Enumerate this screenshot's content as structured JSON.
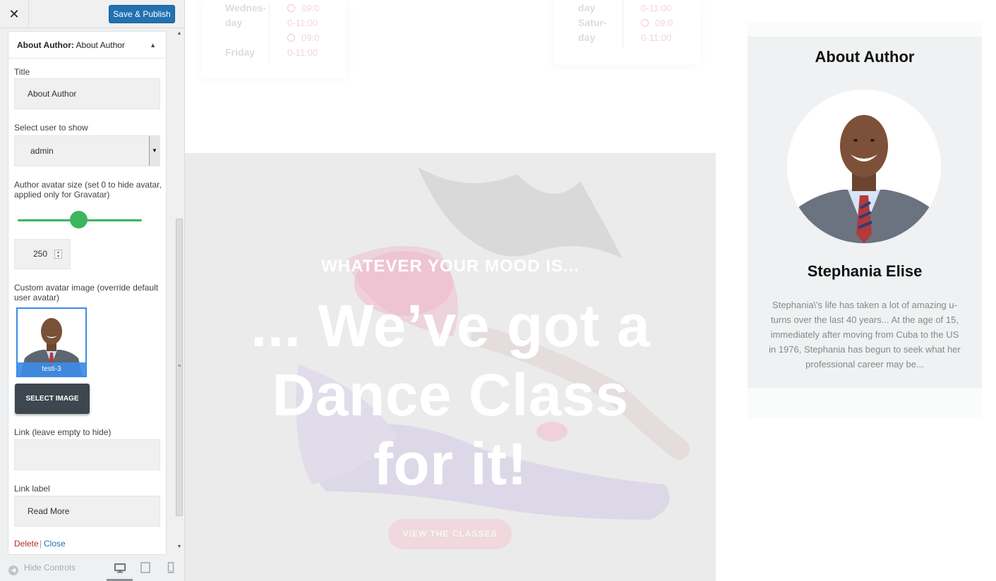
{
  "header": {
    "close_glyph": "✕",
    "publish_label": "Save & Publish"
  },
  "widget": {
    "heading_prefix": "About Author:",
    "heading_title": "About Author",
    "title_label": "Title",
    "title_value": "About Author",
    "user_label": "Select user to show",
    "user_value": "admin",
    "size_label": "Author avatar size (set 0 to hide avatar, applied only for Gravatar)",
    "size_value": "250",
    "size_slider_fraction": 0.49,
    "custom_avatar_label": "Custom avatar image (override default user avatar)",
    "thumb_caption": "testi-3",
    "select_image_label": "SELECT IMAGE",
    "link_label": "Link (leave empty to hide)",
    "link_value": "",
    "linklabel_label": "Link label",
    "linklabel_value": "Read More",
    "delete_label": "Delete",
    "separator": "|",
    "close_label": "Close"
  },
  "footer": {
    "hide_controls_label": "Hide Controls",
    "devices": [
      "desktop-icon",
      "tablet-icon",
      "mobile-icon"
    ]
  },
  "schedule": {
    "left": [
      {
        "day": "Wednes-",
        "time": "09:0"
      },
      {
        "day": "day",
        "time": "0-11:00"
      },
      {
        "day": "",
        "time": "09:0"
      },
      {
        "day": "Friday",
        "time": "0-11:00"
      }
    ],
    "right": [
      {
        "day": "day",
        "time": "0-11:00"
      },
      {
        "day": "Satur-",
        "time": "09:0"
      },
      {
        "day": "day",
        "time": "0-11:00"
      }
    ]
  },
  "hero": {
    "subtitle": "WHATEVER YOUR MOOD IS...",
    "title_line1": "... We’ve got a",
    "title_line2": "Dance Class",
    "title_line3": "for it!",
    "button_label": "VIEW THE CLASSES"
  },
  "author": {
    "title": "About Author",
    "name": "Stephania Elise",
    "bio": "Stephania\\'s life has taken a lot of amazing u-turns over the last 40 years... At the age of 15, immediately after moving from Cuba to the US in 1976, Stephania has begun to seek what her professional career may be..."
  },
  "colors": {
    "accent": "#3cb55e",
    "primary": "#2271b1",
    "delete": "#b32d2e"
  }
}
